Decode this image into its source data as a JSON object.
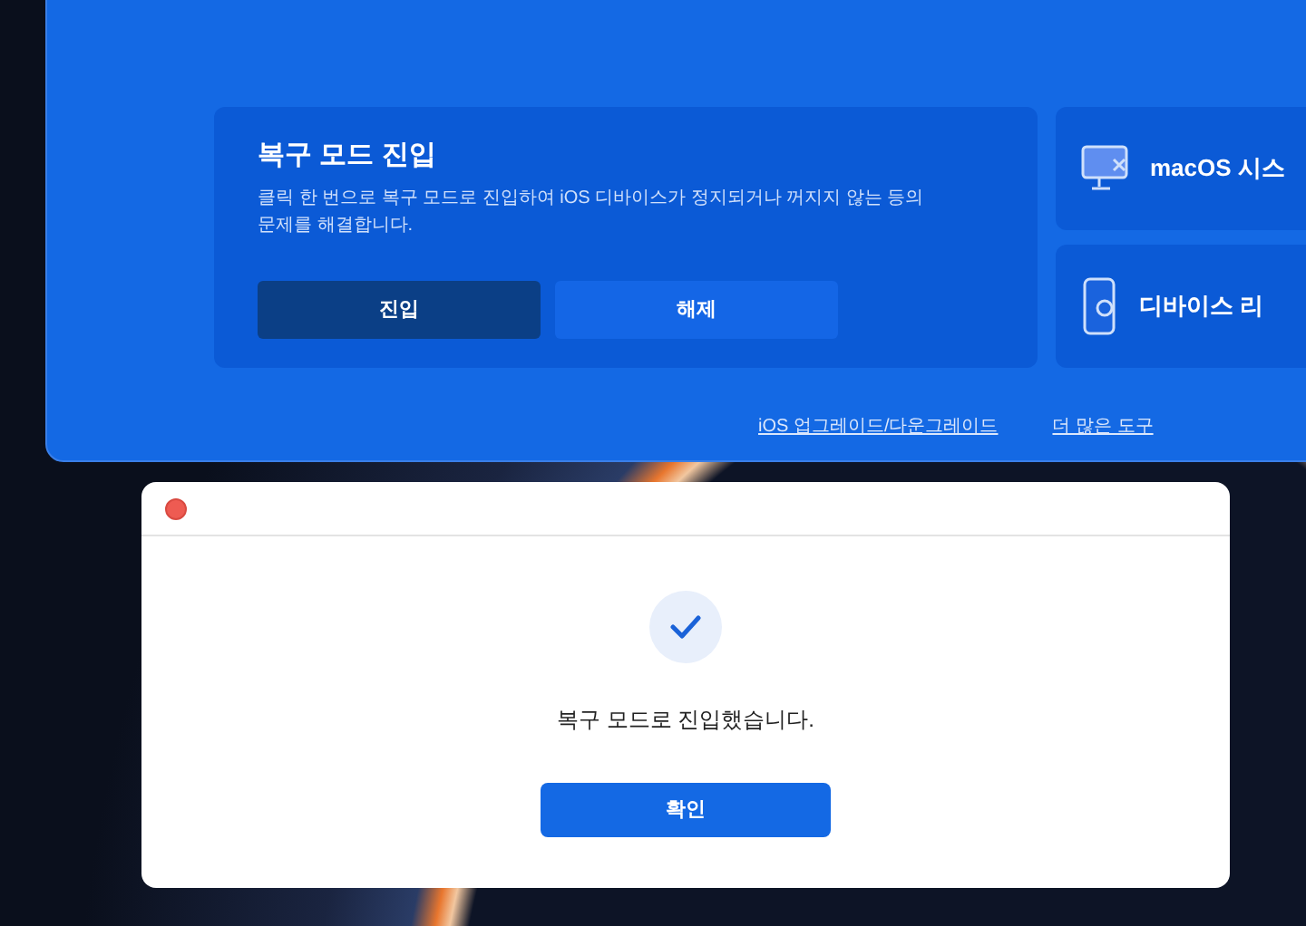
{
  "recovery_card": {
    "title": "복구 모드 진입",
    "description": "클릭 한 번으로 복구 모드로 진입하여 iOS 디바이스가 정지되거나 꺼지지 않는 등의 문제를 해결합니다.",
    "buttons": [
      {
        "label": "진입",
        "kind": "primary"
      },
      {
        "label": "해제",
        "kind": "secondary"
      }
    ]
  },
  "side_cards": [
    {
      "label": "macOS 시스",
      "kind": "monitor"
    },
    {
      "label": "디바이스 리",
      "kind": "phone"
    }
  ],
  "footer_links": [
    "iOS 업그레이드/다운그레이드",
    "더 많은 도구"
  ],
  "dialog": {
    "message": "복구 모드로 진입했습니다.",
    "button": "확인"
  }
}
